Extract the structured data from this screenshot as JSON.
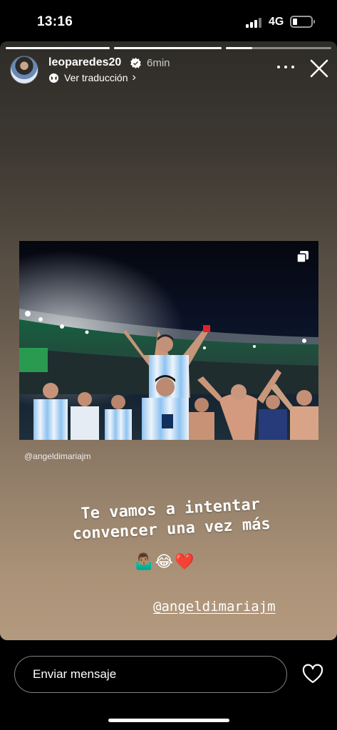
{
  "status_bar": {
    "time": "13:16",
    "network": "4G",
    "battery_level": 0.2
  },
  "story": {
    "progress": [
      1.0,
      1.0,
      0.25
    ],
    "author": {
      "username": "leoparedes20",
      "verified": true,
      "time_ago": "6min",
      "translate_label": "Ver traducción"
    },
    "photo_credit": "@angeldimariajm",
    "caption_lines": [
      "Te vamos a intentar",
      "convencer una vez más"
    ],
    "emojis": "🤷🏽‍♂️😂❤️",
    "mention": "@angeldimariajm"
  },
  "footer": {
    "message_placeholder": "Enviar mensaje"
  },
  "colors": {
    "accent_red": "#e0222b",
    "story_bg_top": "#2e2c28",
    "story_bg_bottom": "#b39a7f"
  }
}
